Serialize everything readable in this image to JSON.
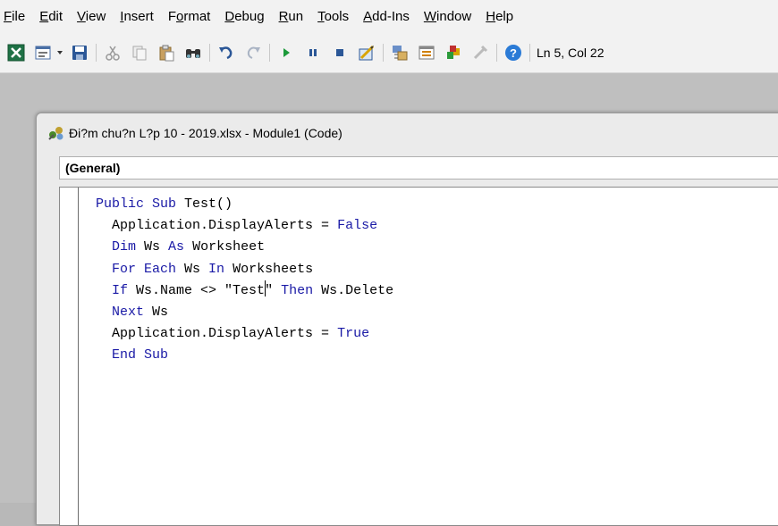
{
  "menu": {
    "items": [
      {
        "label_pre": "",
        "label_u": "F",
        "label_post": "ile"
      },
      {
        "label_pre": "",
        "label_u": "E",
        "label_post": "dit"
      },
      {
        "label_pre": "",
        "label_u": "V",
        "label_post": "iew"
      },
      {
        "label_pre": "",
        "label_u": "I",
        "label_post": "nsert"
      },
      {
        "label_pre": "F",
        "label_u": "o",
        "label_post": "rmat"
      },
      {
        "label_pre": "",
        "label_u": "D",
        "label_post": "ebug"
      },
      {
        "label_pre": "",
        "label_u": "R",
        "label_post": "un"
      },
      {
        "label_pre": "",
        "label_u": "T",
        "label_post": "ools"
      },
      {
        "label_pre": "",
        "label_u": "A",
        "label_post": "dd-Ins"
      },
      {
        "label_pre": "",
        "label_u": "W",
        "label_post": "indow"
      },
      {
        "label_pre": "",
        "label_u": "H",
        "label_post": "elp"
      }
    ]
  },
  "toolbar": {
    "status": "Ln 5, Col 22",
    "icons": [
      "excel-icon",
      "insert-userform-icon",
      "save-icon",
      "cut-icon",
      "copy-icon",
      "paste-icon",
      "find-icon",
      "undo-icon",
      "redo-icon",
      "run-icon",
      "break-icon",
      "reset-icon",
      "design-mode-icon",
      "project-explorer-icon",
      "properties-icon",
      "object-browser-icon",
      "toolbox-icon",
      "help-icon"
    ]
  },
  "window": {
    "title": "Đi?m chu?n L?p 10 - 2019.xlsx - Module1 (Code)",
    "object_combo": "(General)"
  },
  "code": {
    "l1_kw": "Public Sub",
    "l1_rest": " Test()",
    "l2_a": "Application.DisplayAlerts = ",
    "l2_kw": "False",
    "l3_kw1": "Dim",
    "l3_a": " Ws ",
    "l3_kw2": "As",
    "l3_b": " Worksheet",
    "l4_kw1": "For Each",
    "l4_a": " Ws ",
    "l4_kw2": "In",
    "l4_b": " Worksheets",
    "l5_kw1": "If",
    "l5_a": " Ws.Name <> \"Test",
    "l5_b": "\" ",
    "l5_kw2": "Then",
    "l5_c": " Ws.Delete",
    "l6_kw": "Next",
    "l6_a": " Ws",
    "l7_a": "Application.DisplayAlerts = ",
    "l7_kw": "True",
    "l8_kw": "End Sub"
  },
  "colors": {
    "keyword": "#1a1aa6",
    "editor_bg": "#ffffff",
    "mdi_bg": "#bfbfbf"
  }
}
